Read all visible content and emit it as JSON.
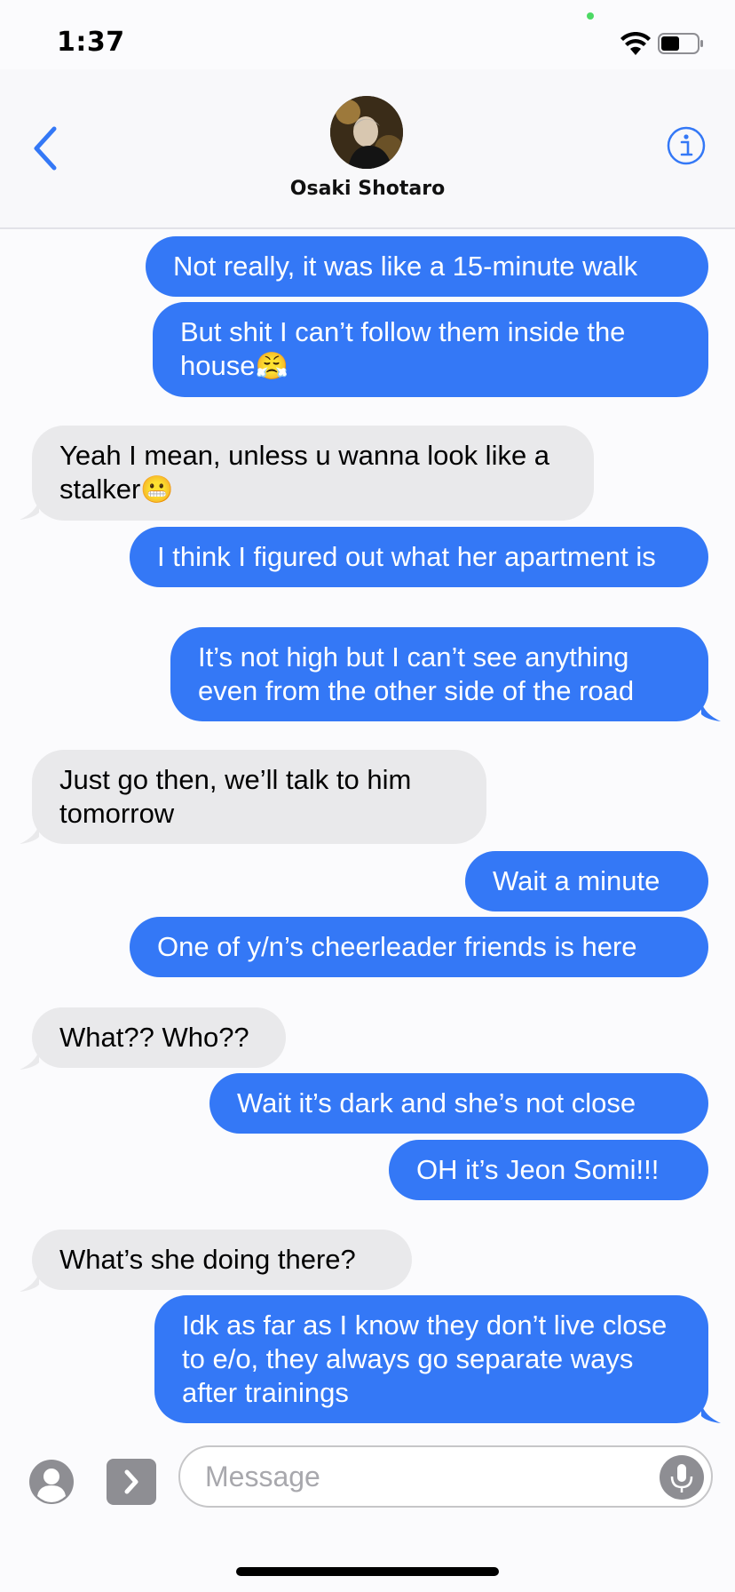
{
  "status_bar": {
    "time": "1:37"
  },
  "header": {
    "contact_name": "Osaki Shotaro",
    "back_icon": "chevron-left-icon",
    "info_icon": "info-icon"
  },
  "messages": [
    {
      "dir": "out",
      "text": "Not really, it was like a 15-minute walk"
    },
    {
      "dir": "out",
      "text": "But shit I can’t follow them inside the house",
      "emoji": "😤"
    },
    {
      "dir": "in",
      "text": "Yeah I mean, unless u wanna look like a stalker",
      "emoji": "😬"
    },
    {
      "dir": "out",
      "text": "I think I figured out what her apartment is"
    },
    {
      "dir": "out",
      "text": "It’s not high but I can’t see anything even from the other side of the road"
    },
    {
      "dir": "in",
      "text": "Just go then, we’ll talk to him tomorrow"
    },
    {
      "dir": "out",
      "text": "Wait a minute"
    },
    {
      "dir": "out",
      "text": "One of y/n’s cheerleader friends is here"
    },
    {
      "dir": "in",
      "text": "What?? Who??"
    },
    {
      "dir": "out",
      "text": "Wait it’s dark and she’s not close"
    },
    {
      "dir": "out",
      "text": "OH it’s Jeon Somi!!!"
    },
    {
      "dir": "in",
      "text": "What’s she doing there?"
    },
    {
      "dir": "out",
      "text": "Idk as far as I know they don’t live close to e/o, they always go separate ways after trainings"
    }
  ],
  "composer": {
    "placeholder": "Message",
    "contact_icon": "contact-card-icon",
    "apps_icon": "apps-chevron-icon",
    "mic_icon": "microphone-icon"
  },
  "colors": {
    "outgoing_bubble": "#3478f6",
    "incoming_bubble": "#e9e9eb",
    "accent": "#3478f6"
  }
}
